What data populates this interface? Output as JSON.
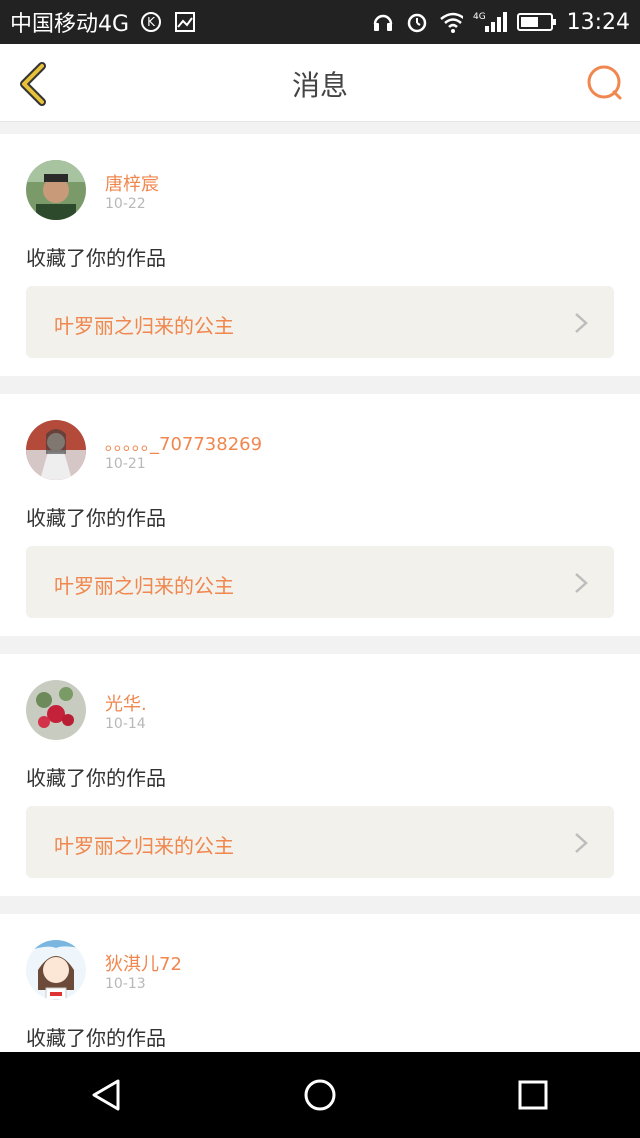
{
  "status_bar": {
    "carrier": "中国移动4G",
    "time": "13:24",
    "icons": [
      "k-circle-icon",
      "image-icon",
      "headphones-icon",
      "alarm-icon",
      "wifi-icon",
      "signal-icon",
      "battery-icon"
    ],
    "signal_label": "4G"
  },
  "header": {
    "title": "消息",
    "back_icon": "chevron-left-icon",
    "search_icon": "search-icon"
  },
  "messages": [
    {
      "user": "唐梓宸",
      "date": "10-22",
      "action": "收藏了你的作品",
      "work_title": "叶罗丽之归来的公主"
    },
    {
      "user": "｡｡｡｡｡_707738269",
      "date": "10-21",
      "action": "收藏了你的作品",
      "work_title": "叶罗丽之归来的公主"
    },
    {
      "user": "光华.",
      "date": "10-14",
      "action": "收藏了你的作品",
      "work_title": "叶罗丽之归来的公主"
    },
    {
      "user": "狄淇儿72",
      "date": "10-13",
      "action": "收藏了你的作品",
      "work_title": ""
    }
  ],
  "nav_bar": {
    "icons": [
      "back-triangle-icon",
      "home-circle-icon",
      "recents-square-icon"
    ]
  },
  "colors": {
    "accent": "#f0874f",
    "card_bg": "#f2f1eb",
    "back_chevron": "#e8c13a"
  }
}
